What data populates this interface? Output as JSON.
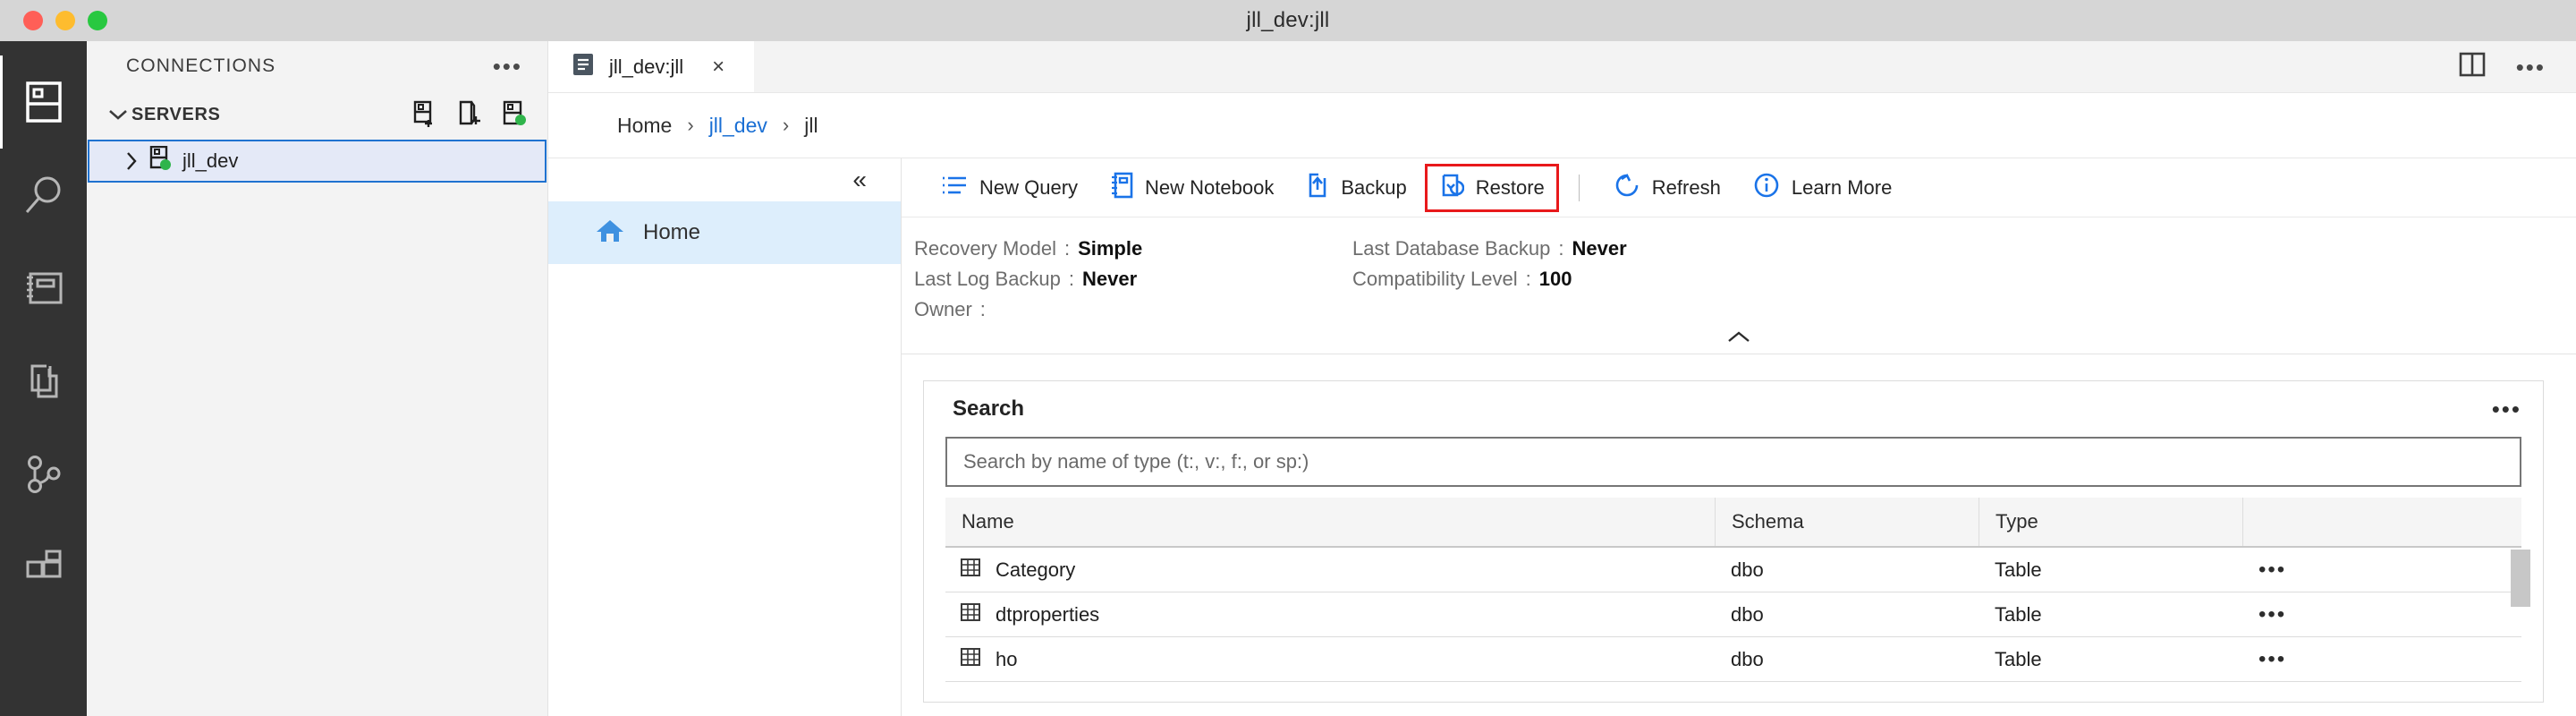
{
  "window": {
    "title": "jll_dev:jll",
    "traffic_lights": [
      "close",
      "minimize",
      "zoom"
    ]
  },
  "activity_bar": {
    "items": [
      {
        "name": "connections",
        "icon": "server-icon",
        "active": true
      },
      {
        "name": "search",
        "icon": "search-icon",
        "active": false
      },
      {
        "name": "notebooks",
        "icon": "notebook-icon",
        "active": false
      },
      {
        "name": "source-files",
        "icon": "copy-files-icon",
        "active": false
      },
      {
        "name": "source-control",
        "icon": "git-branch-icon",
        "active": false
      },
      {
        "name": "extensions",
        "icon": "extensions-icon",
        "active": false
      }
    ]
  },
  "sidebar": {
    "title": "CONNECTIONS",
    "more_label": "•••",
    "section": {
      "label": "SERVERS",
      "expanded": true,
      "actions": [
        {
          "name": "new-connection",
          "icon": "add-connection-icon"
        },
        {
          "name": "new-server-group",
          "icon": "add-server-group-icon"
        },
        {
          "name": "active-connections-filter",
          "icon": "active-connections-icon"
        }
      ]
    },
    "servers": [
      {
        "label": "jll_dev",
        "expanded": false,
        "status": "connected",
        "selected": true
      }
    ]
  },
  "tabbar": {
    "tabs": [
      {
        "label": "jll_dev:jll",
        "icon": "dashboard-icon",
        "active": true,
        "close_label": "×"
      }
    ],
    "actions": [
      {
        "name": "split-editor",
        "icon": "split-editor-icon"
      },
      {
        "name": "editor-more",
        "icon": "ellipsis-icon",
        "label": "•••"
      }
    ]
  },
  "breadcrumb": {
    "separator": "›",
    "items": [
      {
        "label": "Home",
        "link": false
      },
      {
        "label": "jll_dev",
        "link": true
      },
      {
        "label": "jll",
        "link": false
      }
    ]
  },
  "dashboard_nav": {
    "collapse_icon": "«",
    "items": [
      {
        "label": "Home",
        "icon": "home-icon",
        "selected": true
      }
    ]
  },
  "toolbar": {
    "buttons": [
      {
        "name": "new-query",
        "label": "New Query",
        "icon": "new-query-icon",
        "highlighted": false
      },
      {
        "name": "new-notebook",
        "label": "New Notebook",
        "icon": "new-notebook-icon",
        "highlighted": false
      },
      {
        "name": "backup",
        "label": "Backup",
        "icon": "backup-icon",
        "highlighted": false
      },
      {
        "name": "restore",
        "label": "Restore",
        "icon": "restore-icon",
        "highlighted": true
      },
      {
        "name": "refresh",
        "label": "Refresh",
        "icon": "refresh-icon",
        "highlighted": false
      },
      {
        "name": "learn-more",
        "label": "Learn More",
        "icon": "info-icon",
        "highlighted": false
      }
    ],
    "highlight_color": "#e8191b",
    "accent_color": "#1a73e8"
  },
  "properties": {
    "collapse_icon": "⌃",
    "left": [
      {
        "key": "Recovery Model",
        "value": "Simple"
      },
      {
        "key": "Last Log Backup",
        "value": "Never"
      },
      {
        "key": "Owner",
        "value": ""
      }
    ],
    "right": [
      {
        "key": "Last Database Backup",
        "value": "Never"
      },
      {
        "key": "Compatibility Level",
        "value": "100"
      }
    ]
  },
  "search_widget": {
    "title": "Search",
    "more_label": "•••",
    "input": {
      "value": "",
      "placeholder": "Search by name of type (t:, v:, f:, or sp:)"
    },
    "columns": [
      "Name",
      "Schema",
      "Type",
      ""
    ],
    "rows": [
      {
        "name": "Category",
        "schema": "dbo",
        "type": "Table",
        "icon": "table-icon",
        "actions": "•••"
      },
      {
        "name": "dtproperties",
        "schema": "dbo",
        "type": "Table",
        "icon": "table-icon",
        "actions": "•••"
      },
      {
        "name": "ho",
        "schema": "dbo",
        "type": "Table",
        "icon": "table-icon",
        "actions": "•••"
      }
    ]
  }
}
